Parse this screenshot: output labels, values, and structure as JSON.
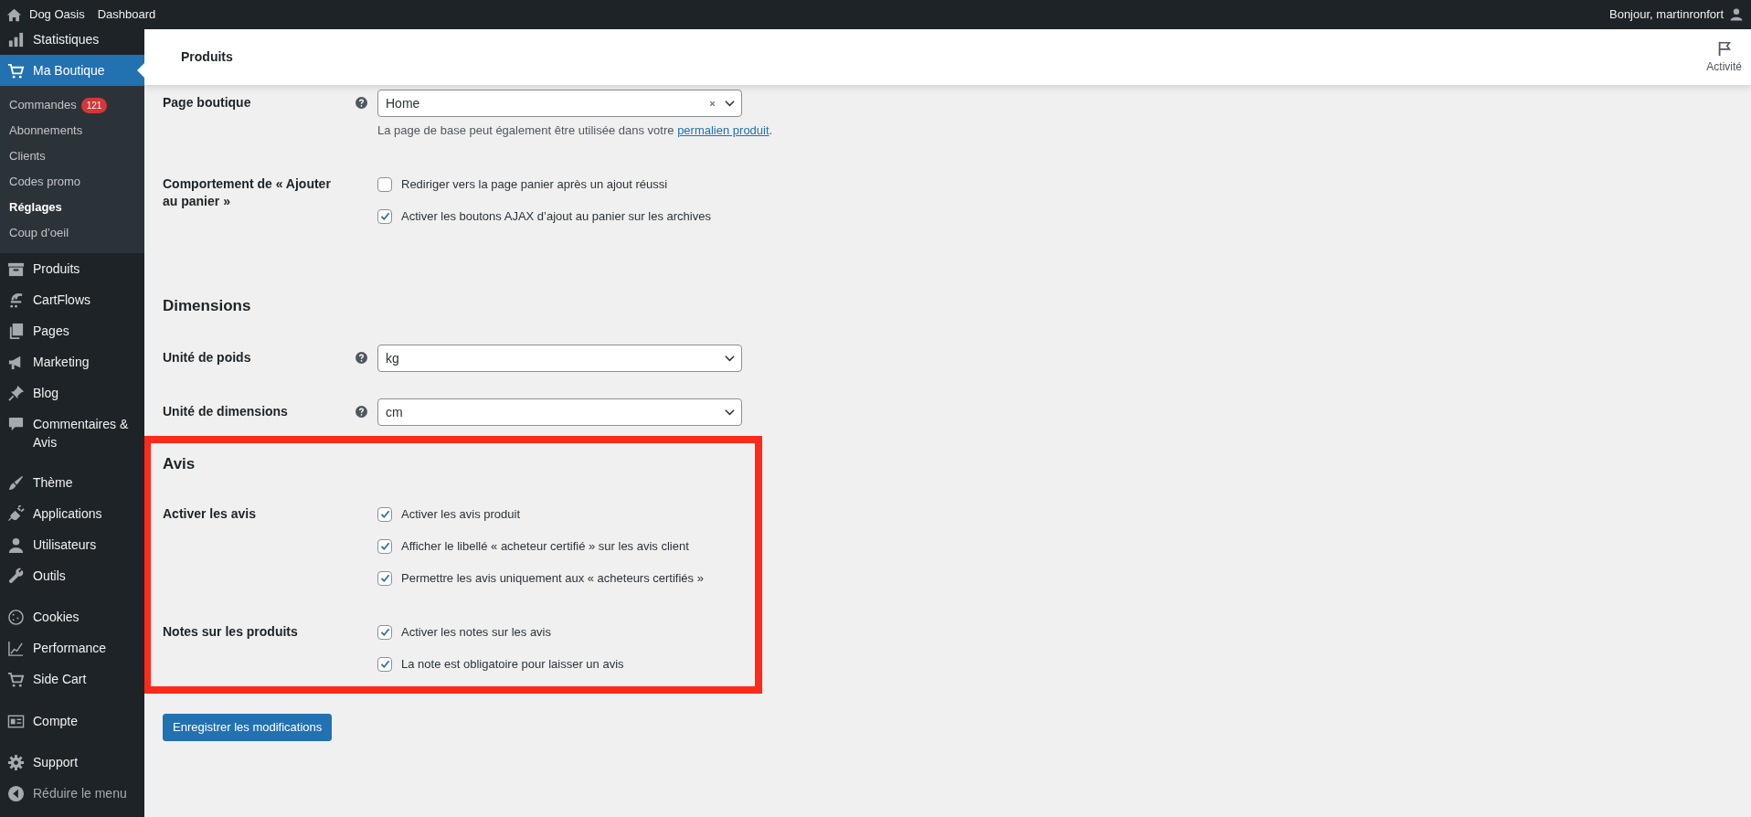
{
  "top_bar": {
    "site_name": "Dog Oasis",
    "dashboard": "Dashboard",
    "greeting": "Bonjour, martinronfort"
  },
  "sidebar": {
    "groups": [
      [
        {
          "label": "Statistiques",
          "selected": false
        },
        {
          "label": "Ma Boutique",
          "selected": true,
          "submenu": [
            {
              "label": "Commandes",
              "badge": "121",
              "selected": false
            },
            {
              "label": "Abonnements",
              "selected": false
            },
            {
              "label": "Clients",
              "selected": false
            },
            {
              "label": "Codes promo",
              "selected": false
            },
            {
              "label": "Réglages",
              "selected": true
            },
            {
              "label": "Coup d’oeil",
              "selected": false
            }
          ]
        },
        {
          "label": "Produits",
          "selected": false
        },
        {
          "label": "CartFlows",
          "selected": false
        },
        {
          "label": "Pages",
          "selected": false
        },
        {
          "label": "Marketing",
          "selected": false
        },
        {
          "label": "Blog",
          "selected": false
        },
        {
          "label": "Commentaires & Avis",
          "selected": false
        }
      ],
      [
        {
          "label": "Thème",
          "selected": false
        },
        {
          "label": "Applications",
          "selected": false
        },
        {
          "label": "Utilisateurs",
          "selected": false
        },
        {
          "label": "Outils",
          "selected": false
        }
      ],
      [
        {
          "label": "Cookies",
          "selected": false
        },
        {
          "label": "Performance",
          "selected": false
        },
        {
          "label": "Side Cart",
          "selected": false
        }
      ],
      [
        {
          "label": "Compte",
          "selected": false
        }
      ],
      [
        {
          "label": "Support",
          "selected": false
        },
        {
          "label": "Réduire le menu",
          "selected": false
        }
      ]
    ]
  },
  "header": {
    "title": "Produits",
    "activity": "Activité"
  },
  "sections": [
    {
      "highlighted": false,
      "rows": [
        {
          "kind": "select",
          "label": "Page boutique",
          "help": true,
          "value": "Home",
          "clearable": true,
          "description": "La page de base peut également être utilisée dans votre ",
          "description_link": "permalien produit",
          "description_end": "."
        },
        {
          "kind": "checkboxes",
          "label": "Comportement de « Ajouter au panier »",
          "help": false,
          "options": [
            {
              "label": "Rediriger vers la page panier après un ajout réussi",
              "checked": false
            },
            {
              "label": "Activer les boutons AJAX d’ajout au panier sur les archives",
              "checked": true
            }
          ]
        }
      ]
    },
    {
      "title": "Dimensions",
      "highlighted": false,
      "rows": [
        {
          "kind": "select",
          "label": "Unité de poids",
          "help": true,
          "value": "kg",
          "clearable": false
        },
        {
          "kind": "select",
          "label": "Unité de dimensions",
          "help": true,
          "value": "cm",
          "clearable": false
        }
      ]
    },
    {
      "title": "Avis",
      "highlighted": true,
      "rows": [
        {
          "kind": "checkboxes",
          "label": "Activer les avis",
          "help": false,
          "options": [
            {
              "label": "Activer les avis produit",
              "checked": true
            },
            {
              "label": "Afficher le libellé « acheteur certifié » sur les avis client",
              "checked": true
            },
            {
              "label": "Permettre les avis uniquement aux « acheteurs certifiés »",
              "checked": true
            }
          ]
        },
        {
          "kind": "checkboxes",
          "label": "Notes sur les produits",
          "help": false,
          "options": [
            {
              "label": "Activer les notes sur les avis",
              "checked": true
            },
            {
              "label": "La note est obligatoire pour laisser un avis",
              "checked": true
            }
          ]
        }
      ]
    }
  ],
  "save_button": "Enregistrer les modifications"
}
